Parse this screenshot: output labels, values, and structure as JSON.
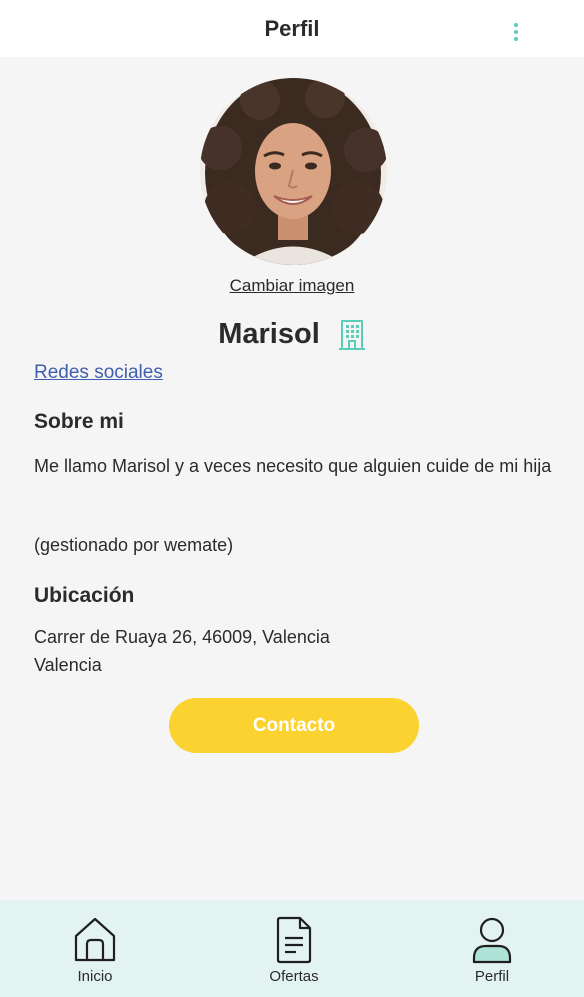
{
  "header": {
    "title": "Perfil",
    "menu_icon": "kebab-menu-icon"
  },
  "profile": {
    "change_image_label": "Cambiar imagen",
    "name": "Marisol",
    "badge_icon": "building-icon",
    "social_link_label": "Redes sociales"
  },
  "about": {
    "title": "Sobre mi",
    "text": "Me llamo Marisol y a veces necesito que alguien cuide de mi hija",
    "managed_note": "(gestionado por wemate)"
  },
  "location": {
    "title": "Ubicación",
    "address_line1": "Carrer de Ruaya 26, 46009, Valencia",
    "address_line2": "Valencia"
  },
  "contact_button": "Contacto",
  "nav": {
    "items": [
      {
        "label": "Inicio",
        "icon": "home-icon"
      },
      {
        "label": "Ofertas",
        "icon": "document-icon"
      },
      {
        "label": "Perfil",
        "icon": "user-icon",
        "active": true
      }
    ]
  },
  "colors": {
    "accent": "#5ccdb6",
    "button": "#fbd22f",
    "link": "#3f5fae",
    "nav_background": "#e3f3f1",
    "page_background": "#f5f5f5"
  }
}
